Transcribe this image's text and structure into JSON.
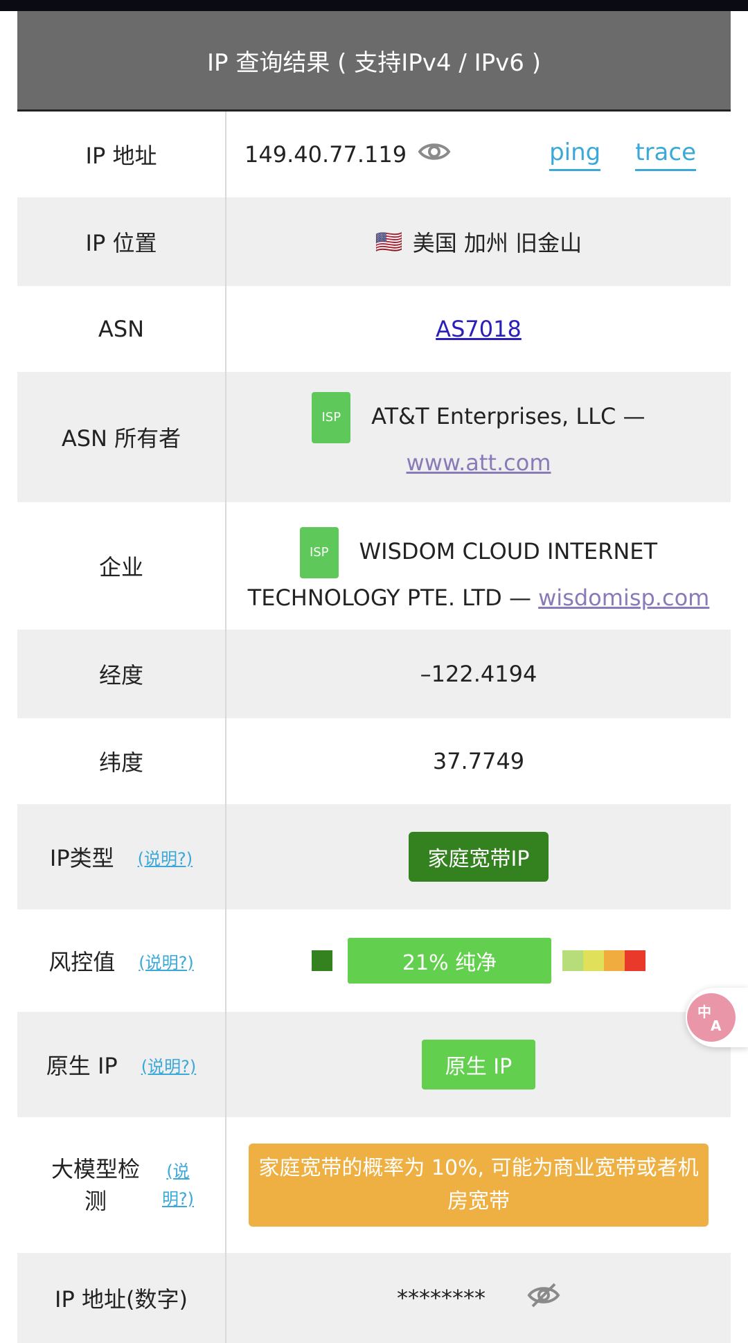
{
  "header": {
    "title": "IP 查询结果 ( 支持IPv4 / IPv6 )"
  },
  "rows": {
    "ip": {
      "label": "IP 地址",
      "value": "149.40.77.119",
      "ping": "ping",
      "trace": "trace"
    },
    "location": {
      "label": "IP 位置",
      "flag": "🇺🇸",
      "value": "美国 加州 旧金山"
    },
    "asn": {
      "label": "ASN",
      "value": "AS7018"
    },
    "asn_owner": {
      "label": "ASN 所有者",
      "badge": "ISP",
      "name": "AT&T Enterprises, LLC —",
      "link": "www.att.com"
    },
    "company": {
      "label": "企业",
      "badge": "ISP",
      "name": "WISDOM CLOUD INTERNET TECHNOLOGY PTE. LTD —",
      "link": "wisdomisp.com"
    },
    "longitude": {
      "label": "经度",
      "value": "–122.4194"
    },
    "latitude": {
      "label": "纬度",
      "value": "37.7749"
    },
    "ip_type": {
      "label": "IP类型",
      "note": "(说明?)",
      "value": "家庭宽带IP"
    },
    "risk": {
      "label": "风控值",
      "note": "(说明?)",
      "value": "21%  纯净",
      "percent": 21,
      "scale_colors": [
        "#b7dd7a",
        "#e1e05a",
        "#f0ac3f",
        "#e8392b"
      ]
    },
    "native": {
      "label": "原生 IP",
      "note": "(说明?)",
      "value": "原生 IP"
    },
    "llm": {
      "label": "大模型检测",
      "note": "(说明?)",
      "value": "家庭宽带的概率为 10%, 可能为商业宽带或者机房宽带"
    },
    "ip_numeric": {
      "label": "IP 地址(数字)",
      "value": "********"
    }
  },
  "colors": {
    "header_bg": "#6b6b6b",
    "link": "#3aa8d8",
    "green_dark": "#34811f",
    "green": "#62cf4e",
    "orange": "#eeb043"
  },
  "icons": {
    "eye": "eye-icon",
    "eye_off": "eye-off-icon",
    "translate": "translate-icon"
  }
}
